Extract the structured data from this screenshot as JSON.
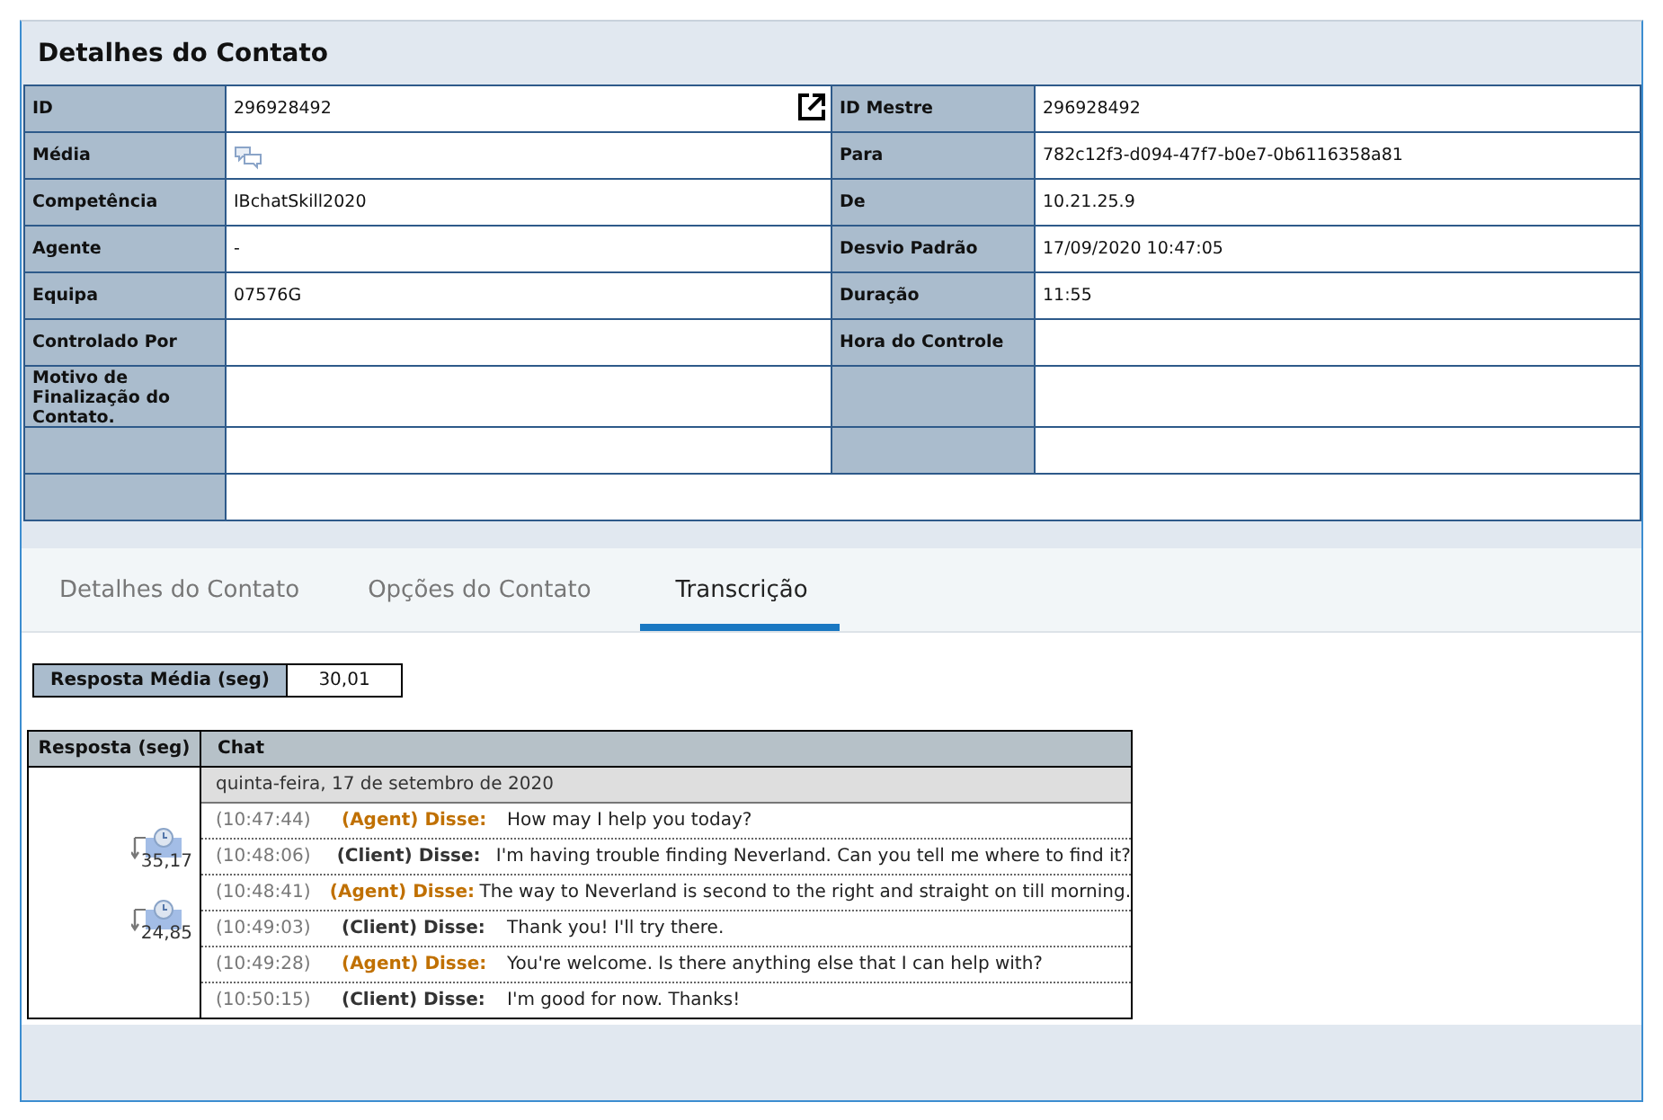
{
  "title": "Detalhes do Contato",
  "details": [
    {
      "label": "ID",
      "value": "296928492",
      "kind": "text",
      "external_link": true
    },
    {
      "label": "ID Mestre",
      "value": "296928492",
      "kind": "text",
      "external_link": false
    },
    {
      "label": "Média",
      "kind": "chat-icon",
      "external_link": false
    },
    {
      "label": "Para",
      "value": "782c12f3-d094-47f7-b0e7-0b6116358a81",
      "kind": "text",
      "external_link": false
    },
    {
      "label": "Competência",
      "value": "IBchatSkill2020",
      "kind": "text",
      "external_link": false
    },
    {
      "label": "De",
      "value": "10.21.25.9",
      "kind": "text",
      "external_link": false
    },
    {
      "label": "Agente",
      "value": "-",
      "kind": "text",
      "external_link": false
    },
    {
      "label": "Desvio Padrão",
      "value": "17/09/2020 10:47:05",
      "kind": "text",
      "external_link": false
    },
    {
      "label": "Equipa",
      "value": "07576G",
      "kind": "text",
      "external_link": false
    },
    {
      "label": "Duração",
      "value": "11:55",
      "kind": "text",
      "external_link": false
    },
    {
      "label": "Controlado Por",
      "kind": "text",
      "external_link": false
    },
    {
      "label": "Hora do Controle",
      "kind": "text",
      "external_link": false
    },
    {
      "label": "Motivo de Finalização do Contato.",
      "kind": "text",
      "external_link": false
    }
  ],
  "tabs": [
    {
      "label": "Detalhes do Contato",
      "selected": false
    },
    {
      "label": "Opções do Contato",
      "selected": false
    },
    {
      "label": "Transcrição",
      "selected": true
    }
  ],
  "average_response": {
    "label": "Resposta Média (seg)",
    "value": "30,01"
  },
  "transcript": {
    "columns": [
      "Resposta (seg)",
      "Chat"
    ],
    "date": "quinta-feira, 17 de setembro de 2020",
    "responses": [
      "35,17",
      "24,85"
    ],
    "messages": [
      {
        "time": "(10:47:44)",
        "speaker": "(Agent) Disse:",
        "kind": "agent",
        "text": "How may I help you today?"
      },
      {
        "time": "(10:48:06)",
        "speaker": "(Client) Disse:",
        "kind": "client",
        "text": "I'm having trouble finding Neverland. Can you tell me where to find it?"
      },
      {
        "time": "(10:48:41)",
        "speaker": "(Agent) Disse:",
        "kind": "agent",
        "text": "The way to Neverland is second to the right and straight on till morning."
      },
      {
        "time": "(10:49:03)",
        "speaker": "(Client) Disse:",
        "kind": "client",
        "text": "Thank you! I'll try there."
      },
      {
        "time": "(10:49:28)",
        "speaker": "(Agent) Disse:",
        "kind": "agent",
        "text": "You're welcome. Is there anything else that I can help with?"
      },
      {
        "time": "(10:50:15)",
        "speaker": "(Client) Disse:",
        "kind": "client",
        "text": "I'm good for now. Thanks!"
      }
    ]
  }
}
